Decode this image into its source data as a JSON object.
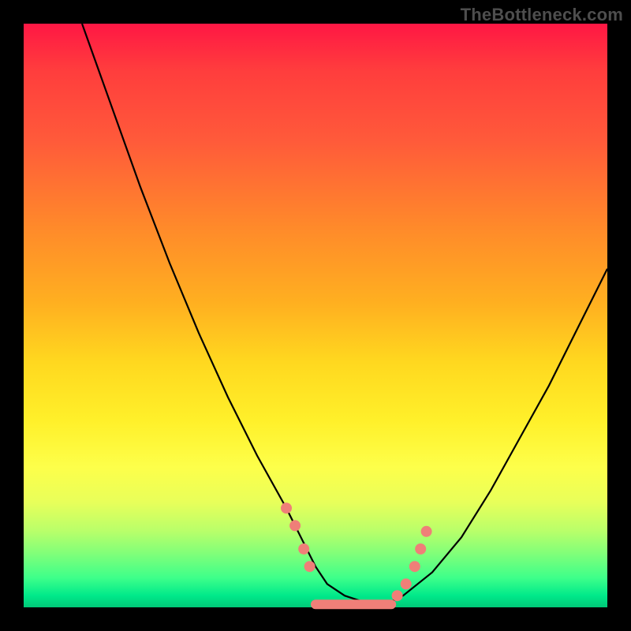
{
  "watermark": "TheBottleneck.com",
  "chart_data": {
    "type": "line",
    "title": "",
    "xlabel": "",
    "ylabel": "",
    "xlim": [
      0,
      100
    ],
    "ylim": [
      0,
      100
    ],
    "grid": false,
    "series": [
      {
        "name": "curve",
        "color": "#000000",
        "x": [
          10,
          15,
          20,
          25,
          30,
          35,
          40,
          45,
          48,
          50,
          52,
          55,
          58,
          60,
          63,
          65,
          70,
          75,
          80,
          85,
          90,
          95,
          100
        ],
        "y": [
          100,
          86,
          72,
          59,
          47,
          36,
          26,
          17,
          11,
          7,
          4,
          2,
          1,
          0.5,
          1,
          2,
          6,
          12,
          20,
          29,
          38,
          48,
          58
        ]
      }
    ],
    "annotations": {
      "flat_bottom": {
        "x_start": 50,
        "x_end": 63,
        "y": 0.5
      },
      "left_dots": [
        {
          "x": 45,
          "y": 17
        },
        {
          "x": 46.5,
          "y": 14
        },
        {
          "x": 48,
          "y": 10
        },
        {
          "x": 49,
          "y": 7
        }
      ],
      "right_dots": [
        {
          "x": 64,
          "y": 2
        },
        {
          "x": 65.5,
          "y": 4
        },
        {
          "x": 67,
          "y": 7
        },
        {
          "x": 68,
          "y": 10
        },
        {
          "x": 69,
          "y": 13
        }
      ]
    },
    "gradient_stops": [
      {
        "pos": 0,
        "color": "#ff1744"
      },
      {
        "pos": 50,
        "color": "#ffcc20"
      },
      {
        "pos": 80,
        "color": "#fdff4a"
      },
      {
        "pos": 100,
        "color": "#00c978"
      }
    ]
  }
}
